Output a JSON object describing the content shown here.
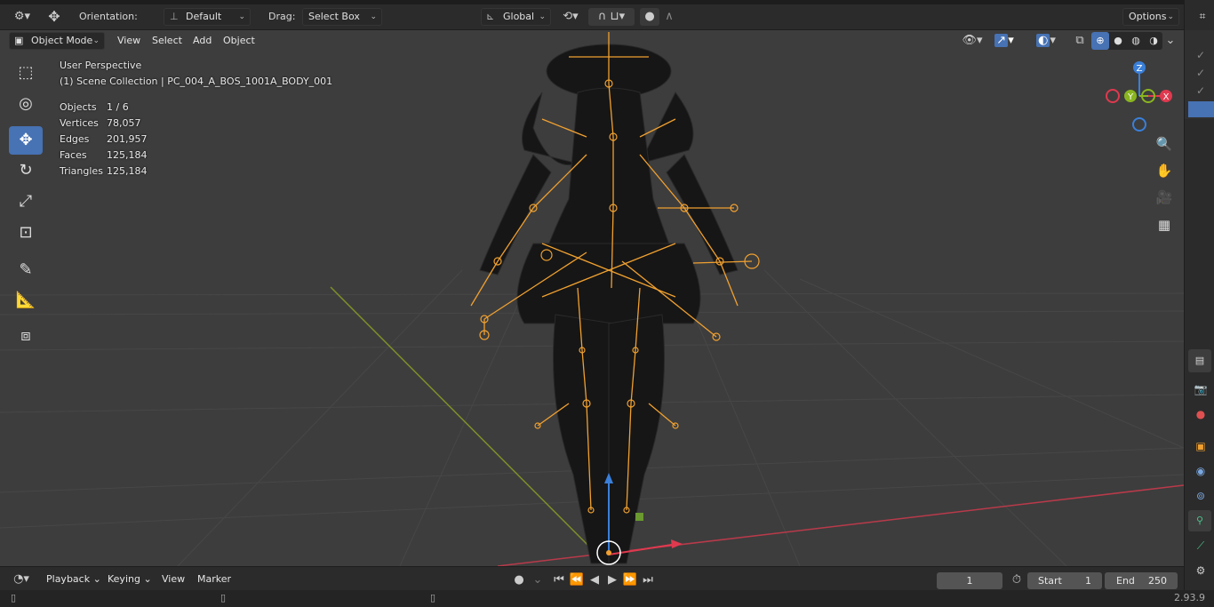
{
  "topbar": {
    "orientation_label": "Orientation:",
    "orientation_value": "Default",
    "drag_label": "Drag:",
    "drag_value": "Select Box",
    "transform_space": "Global",
    "options_label": "Options"
  },
  "viewport_header": {
    "mode": "Object Mode",
    "menus": [
      "View",
      "Select",
      "Add",
      "Object"
    ]
  },
  "overlay": {
    "view_name": "User Perspective",
    "collection": "(1) Scene Collection | PC_004_A_BOS_1001A_BODY_001",
    "stats": [
      {
        "key": "Objects",
        "value": "1 / 6"
      },
      {
        "key": "Vertices",
        "value": "78,057"
      },
      {
        "key": "Edges",
        "value": "201,957"
      },
      {
        "key": "Faces",
        "value": "125,184"
      },
      {
        "key": "Triangles",
        "value": "125,184"
      }
    ]
  },
  "gizmo": {
    "z": "Z",
    "y": "Y",
    "x": "X"
  },
  "tools": [
    "select-box-icon",
    "cursor-icon",
    "move-icon",
    "rotate-icon",
    "scale-icon",
    "transform-icon",
    "annotate-icon",
    "measure-icon",
    "add-cube-icon"
  ],
  "colors": {
    "accent": "#4772b3",
    "armature": "#f0a030",
    "x_axis": "#e0394f",
    "y_axis": "#8ab520",
    "z_axis": "#3a7fd9"
  },
  "timeline": {
    "playback": "Playback",
    "keying": "Keying",
    "view": "View",
    "marker": "Marker",
    "current_frame": "1",
    "start_label": "Start",
    "start_value": "1",
    "end_label": "End",
    "end_value": "250"
  },
  "statusbar": {
    "version": "2.93.9"
  }
}
